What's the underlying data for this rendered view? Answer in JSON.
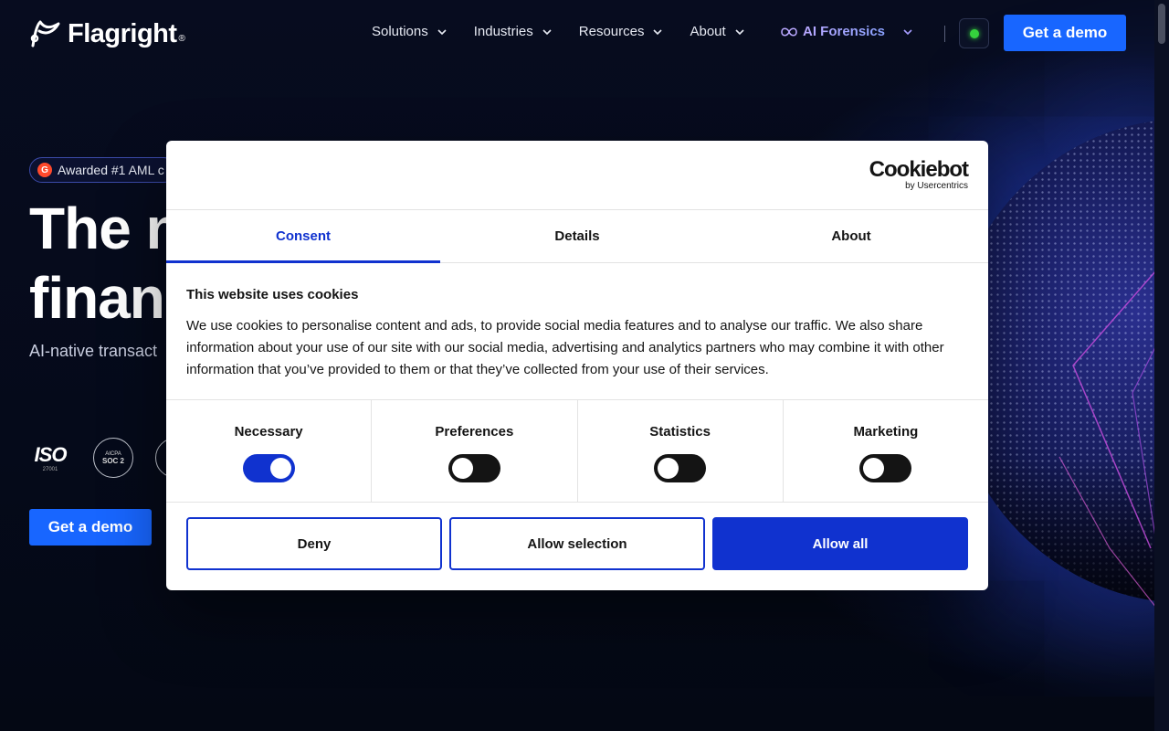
{
  "header": {
    "brand": "Flagright",
    "brand_mark": "®",
    "nav": [
      {
        "label": "Solutions"
      },
      {
        "label": "Industries"
      },
      {
        "label": "Resources"
      },
      {
        "label": "About"
      }
    ],
    "ai_label": "AI Forensics",
    "cta": "Get a demo",
    "status_color": "#35d23d"
  },
  "hero": {
    "award_badge": "G",
    "award_text": "Awarded #1 AML c",
    "title_line1": "The n",
    "title_line2": "finan",
    "subtitle": "AI-native transact",
    "iso_label": "ISO",
    "iso_year": "27001",
    "soc_top": "AICPA",
    "soc_label": "SOC 2",
    "cta": "Get a demo"
  },
  "cookie_dialog": {
    "brand": "Cookiebot",
    "brand_sub": "by Usercentrics",
    "tabs": [
      {
        "label": "Consent",
        "active": true
      },
      {
        "label": "Details",
        "active": false
      },
      {
        "label": "About",
        "active": false
      }
    ],
    "heading": "This website uses cookies",
    "text": "We use cookies to personalise content and ads, to provide social media features and to analyse our traffic. We also share information about your use of our site with our social media, advertising and analytics partners who may combine it with other information that you’ve provided to them or that they’ve collected from your use of their services.",
    "toggles": [
      {
        "label": "Necessary",
        "on": true
      },
      {
        "label": "Preferences",
        "on": false
      },
      {
        "label": "Statistics",
        "on": false
      },
      {
        "label": "Marketing",
        "on": false
      }
    ],
    "buttons": {
      "deny": "Deny",
      "allow_selection": "Allow selection",
      "allow_all": "Allow all"
    },
    "accent_color": "#1032cf"
  },
  "colors": {
    "cta_blue": "#1866ff",
    "background": "#050a1a"
  }
}
